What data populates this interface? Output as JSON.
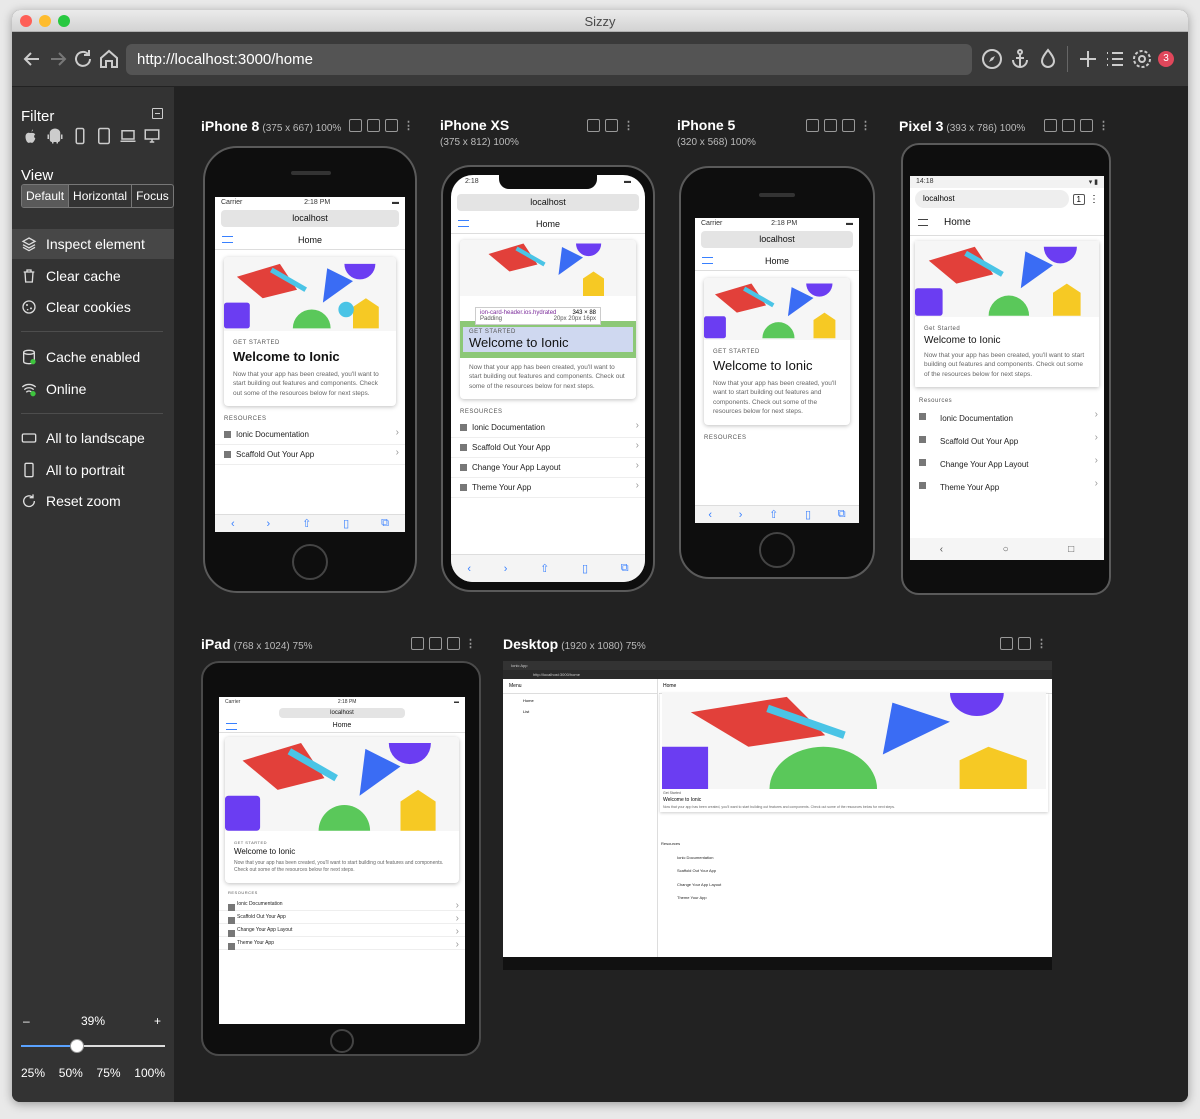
{
  "window": {
    "title": "Sizzy"
  },
  "toolbar": {
    "url": "http://localhost:3000/home",
    "notification_count": "3"
  },
  "sidebar": {
    "filter_label": "Filter",
    "view_label": "View",
    "view_modes": [
      "Default",
      "Horizontal",
      "Focus"
    ],
    "active_view": "Default",
    "items": [
      {
        "label": "Inspect element",
        "icon": "layers-icon"
      },
      {
        "label": "Clear cache",
        "icon": "trash-icon"
      },
      {
        "label": "Clear cookies",
        "icon": "cookie-icon"
      },
      {
        "label": "Cache enabled",
        "icon": "database-icon"
      },
      {
        "label": "Online",
        "icon": "wifi-icon"
      },
      {
        "label": "All to landscape",
        "icon": "landscape-icon"
      },
      {
        "label": "All to portrait",
        "icon": "portrait-icon"
      },
      {
        "label": "Reset zoom",
        "icon": "reset-icon"
      }
    ],
    "zoom": {
      "minus": "–",
      "value": "39%",
      "plus": "+",
      "level": 0.39,
      "presets": [
        "25%",
        "50%",
        "75%",
        "100%"
      ]
    }
  },
  "devices": {
    "iphone8": {
      "name": "iPhone 8",
      "dims": "(375 x 667) 100%"
    },
    "iphonexs": {
      "name": "iPhone XS",
      "dims": "(375 x 812) 100%"
    },
    "iphone5": {
      "name": "iPhone 5",
      "dims": "(320 x 568) 100%"
    },
    "pixel3": {
      "name": "Pixel 3",
      "dims": "(393 x 786) 100%"
    },
    "ipad": {
      "name": "iPad",
      "dims": "(768 x 1024) 75%"
    },
    "desktop": {
      "name": "Desktop",
      "dims": "(1920 x 1080) 75%"
    }
  },
  "app": {
    "carrier": "Carrier",
    "time": "2:18 PM",
    "time_xs": "2:18",
    "time_pixel": "14:18",
    "host": "localhost",
    "page_title": "Home",
    "card_label": "GET STARTED",
    "card_label_android": "Get Started",
    "card_title": "Welcome to Ionic",
    "card_text": "Now that your app has been created, you'll want to start building out features and components. Check out some of the resources below for next steps.",
    "resources_label": "RESOURCES",
    "resources_label_android": "Resources",
    "links": [
      "Ionic Documentation",
      "Scaffold Out Your App",
      "Change Your App Layout",
      "Theme Your App"
    ],
    "inspect_tooltip": {
      "selector": "ion-card-header.ios.hydrated",
      "size": "343 × 88",
      "padding_label": "Padding",
      "padding_value": "20px 20px 16px"
    },
    "desktop_menu": {
      "title": "Menu",
      "items": [
        "Home",
        "List"
      ]
    },
    "desktop_tab": "Ionic App",
    "desktop_url": "http://localhost:3000/home",
    "pixel_tabs": "1"
  },
  "colors": {
    "accent": "#3880ff",
    "red": "#e2403a",
    "blue": "#3a6cf4",
    "purple": "#6b3df2",
    "green": "#5ac85a",
    "yellow": "#f6c924",
    "cyan": "#4ac4e6"
  }
}
